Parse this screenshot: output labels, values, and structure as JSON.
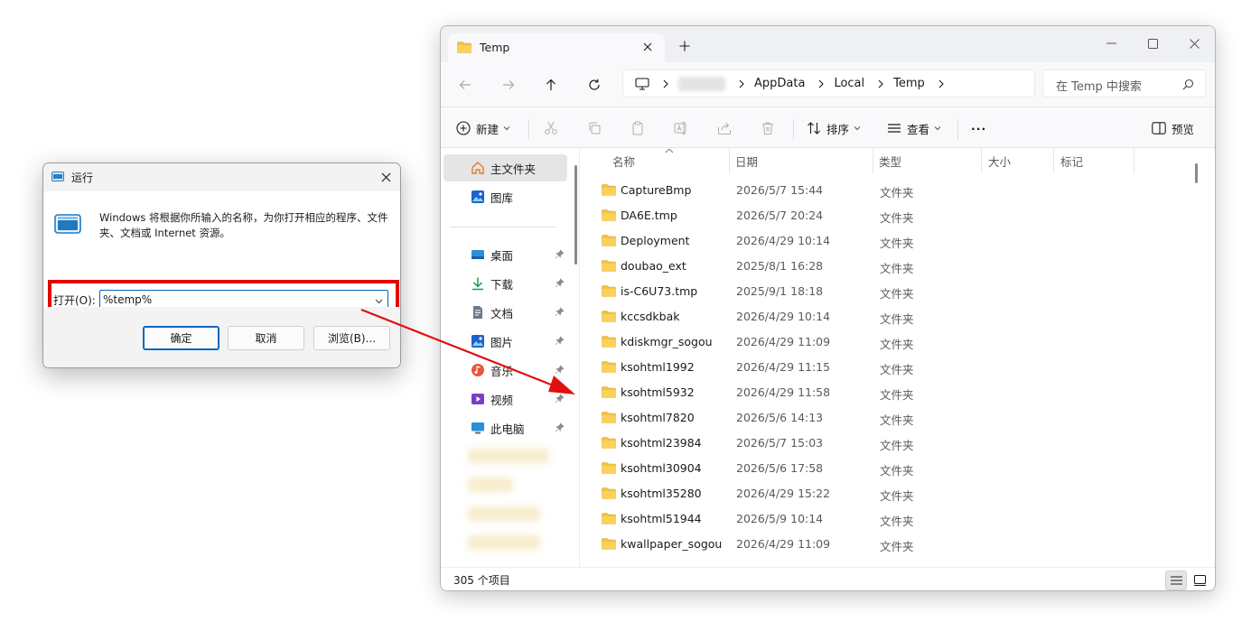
{
  "run_dialog": {
    "title": "运行",
    "description": "Windows 将根据你所输入的名称，为你打开相应的程序、文件夹、文档或 Internet 资源。",
    "open_label": "打开(O):",
    "open_value": "%temp%",
    "ok_label": "确定",
    "cancel_label": "取消",
    "browse_label": "浏览(B)...",
    "highlight_color": "#e50000"
  },
  "explorer": {
    "tab_title": "Temp",
    "breadcrumb": [
      "AppData",
      "Local",
      "Temp"
    ],
    "search_placeholder": "在 Temp 中搜索",
    "commands": {
      "new_label": "新建",
      "sort_label": "排序",
      "view_label": "查看",
      "more_label": "···",
      "preview_label": "预览"
    },
    "sidebar": {
      "home_label": "主文件夹",
      "gallery_label": "图库",
      "items": [
        {
          "label": "桌面",
          "icon": "desktop-icon"
        },
        {
          "label": "下载",
          "icon": "download-icon"
        },
        {
          "label": "文档",
          "icon": "document-icon"
        },
        {
          "label": "图片",
          "icon": "picture-icon"
        },
        {
          "label": "音乐",
          "icon": "music-icon"
        },
        {
          "label": "视频",
          "icon": "video-icon"
        },
        {
          "label": "此电脑",
          "icon": "this-pc-icon"
        }
      ]
    },
    "columns": [
      "名称",
      "日期",
      "类型",
      "大小",
      "标记"
    ],
    "files": [
      {
        "name": "CaptureBmp",
        "date": "2026/5/7 15:44",
        "type": "文件夹"
      },
      {
        "name": "DA6E.tmp",
        "date": "2026/5/7 20:24",
        "type": "文件夹"
      },
      {
        "name": "Deployment",
        "date": "2026/4/29 10:14",
        "type": "文件夹"
      },
      {
        "name": "doubao_ext",
        "date": "2025/8/1 16:28",
        "type": "文件夹"
      },
      {
        "name": "is-C6U73.tmp",
        "date": "2025/9/1 18:18",
        "type": "文件夹"
      },
      {
        "name": "kccsdkbak",
        "date": "2026/4/29 10:14",
        "type": "文件夹"
      },
      {
        "name": "kdiskmgr_sogou",
        "date": "2026/4/29 11:09",
        "type": "文件夹"
      },
      {
        "name": "ksohtml1992",
        "date": "2026/4/29 11:15",
        "type": "文件夹"
      },
      {
        "name": "ksohtml5932",
        "date": "2026/4/29 11:58",
        "type": "文件夹"
      },
      {
        "name": "ksohtml7820",
        "date": "2026/5/6 14:13",
        "type": "文件夹"
      },
      {
        "name": "ksohtml23984",
        "date": "2026/5/7 15:03",
        "type": "文件夹"
      },
      {
        "name": "ksohtml30904",
        "date": "2026/5/6 17:58",
        "type": "文件夹"
      },
      {
        "name": "ksohtml35280",
        "date": "2026/4/29 15:22",
        "type": "文件夹"
      },
      {
        "name": "ksohtml51944",
        "date": "2026/5/9 10:14",
        "type": "文件夹"
      },
      {
        "name": "kwallpaper_sogou",
        "date": "2026/4/29 11:09",
        "type": "文件夹"
      }
    ],
    "status": "305 个项目",
    "folder_color": "#f5c242",
    "arrow_color": "#e01010"
  }
}
